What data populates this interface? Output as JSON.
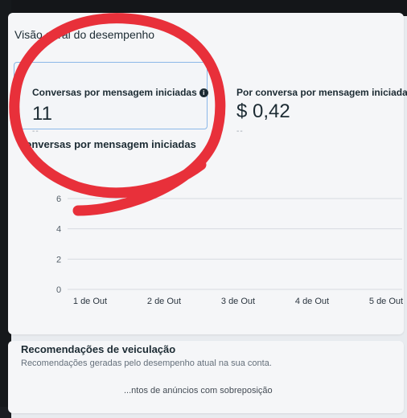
{
  "overview": {
    "title": "Visão geral do desempenho"
  },
  "metrics": [
    {
      "label": "Conversas por mensagem iniciadas",
      "value": "11",
      "sub": "--"
    },
    {
      "label": "Por conversa por mensagem iniciada",
      "value": "$ 0,42",
      "sub": "--"
    }
  ],
  "chart_data": {
    "type": "line",
    "title": "Conversas por mensagem iniciadas",
    "categories": [
      "1 de Out",
      "2 de Out",
      "3 de Out",
      "4 de Out",
      "5 de Out"
    ],
    "yticks": [
      0,
      2,
      4,
      6
    ],
    "ylim": [
      0,
      6
    ],
    "grid": true,
    "series": []
  },
  "recommendations": {
    "title": "Recomendações de veiculação",
    "subtitle": "Recomendações geradas pelo desempenho atual na sua conta.",
    "partial_item": "...ntos de anúncios com sobreposição"
  },
  "colors": {
    "annotation": "#e8303a",
    "accent_border": "#8bb8e8",
    "background": "#e8ebef"
  },
  "icons": {
    "info": "info-icon"
  }
}
